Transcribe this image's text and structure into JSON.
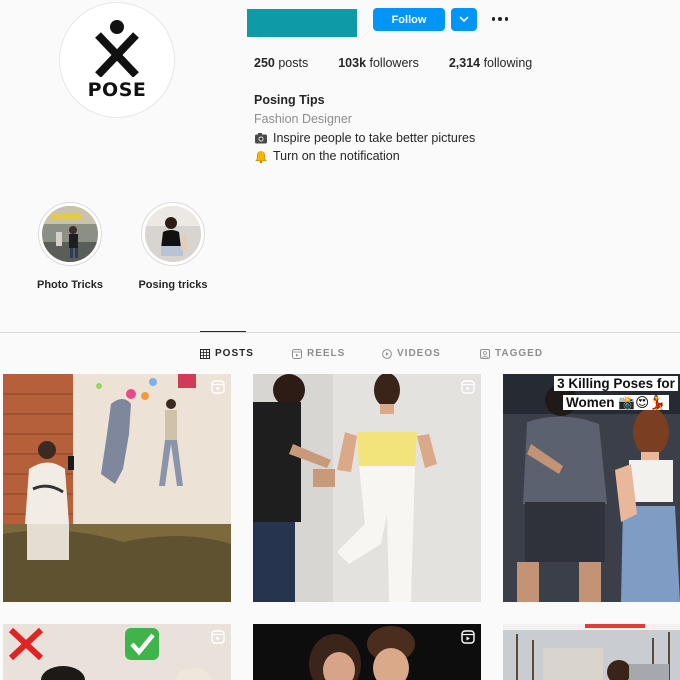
{
  "profile": {
    "avatar_text": "POSE",
    "follow_label": "Follow",
    "stats": [
      {
        "value": "250",
        "label": " posts"
      },
      {
        "value": "103k",
        "label": " followers"
      },
      {
        "value": "2,314",
        "label": " following"
      }
    ],
    "bio": {
      "name": "Posing Tips",
      "category": "Fashion Designer",
      "line1": "Inspire people to take better pictures",
      "line2": "Turn on the notification"
    },
    "accent_color": "#0095f6",
    "username_block_color": "#0e9aa7"
  },
  "highlights": [
    {
      "label": "Photo Tricks"
    },
    {
      "label": "Posing tricks"
    }
  ],
  "tabs": [
    {
      "label": "POSTS",
      "icon": "grid-icon",
      "active": true
    },
    {
      "label": "REELS",
      "icon": "reels-icon",
      "active": false
    },
    {
      "label": "VIDEOS",
      "icon": "play-icon",
      "active": false
    },
    {
      "label": "TAGGED",
      "icon": "tag-icon",
      "active": false
    }
  ],
  "posts": [
    {
      "type": "reel",
      "caption": ""
    },
    {
      "type": "reel",
      "caption": ""
    },
    {
      "type": "post",
      "caption_line1": "3 Killing Poses for",
      "caption_line2": "Women 📸😍💃"
    },
    {
      "type": "reel",
      "caption": ""
    },
    {
      "type": "reel",
      "caption": ""
    },
    {
      "type": "post",
      "caption": ""
    }
  ]
}
